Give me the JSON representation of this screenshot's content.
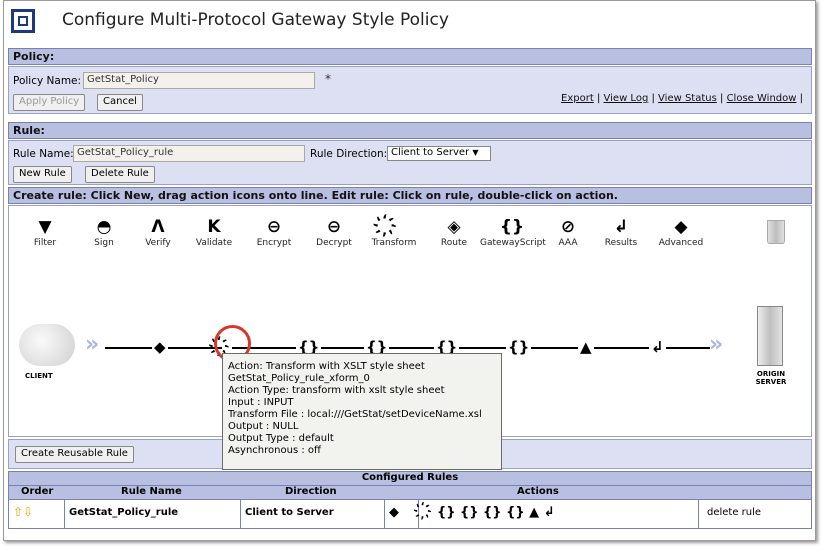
{
  "window": {
    "title": "Configure Multi-Protocol Gateway Style Policy"
  },
  "policy": {
    "header": "Policy:",
    "name_label": "Policy Name:",
    "name_value": "GetStat_Policy",
    "required_marker": "*",
    "apply_label": "Apply Policy",
    "cancel_label": "Cancel",
    "links": [
      "Export",
      "View Log",
      "View Status",
      "Close Window"
    ],
    "separator": "|"
  },
  "rule": {
    "header": "Rule:",
    "name_label": "Rule Name:",
    "name_value": "GetStat_Policy_rule",
    "direction_label": "Rule Direction:",
    "direction_value": "Client to Server",
    "direction_arrow": "▼",
    "new_label": "New Rule",
    "delete_label": "Delete Rule"
  },
  "instructions": "Create rule: Click New, drag action icons onto line.   Edit rule: Click on rule, double-click on action.",
  "palette": [
    {
      "label": "Filter",
      "icon": "filter-icon",
      "glyph": "▼"
    },
    {
      "label": "Sign",
      "icon": "sign-icon",
      "glyph": "◓"
    },
    {
      "label": "Verify",
      "icon": "verify-icon",
      "glyph": "Λ"
    },
    {
      "label": "Validate",
      "icon": "validate-icon",
      "glyph": "K"
    },
    {
      "label": "Encrypt",
      "icon": "encrypt-icon",
      "glyph": "⊖"
    },
    {
      "label": "Decrypt",
      "icon": "decrypt-icon",
      "glyph": "⊖"
    },
    {
      "label": "Transform",
      "icon": "transform-icon",
      "glyph": "҉"
    },
    {
      "label": "Route",
      "icon": "route-icon",
      "glyph": "◈"
    },
    {
      "label": "GatewayScript",
      "icon": "gatewayscript-icon",
      "glyph": "{}"
    },
    {
      "label": "AAA",
      "icon": "aaa-icon",
      "glyph": "⊘"
    },
    {
      "label": "Results",
      "icon": "results-icon",
      "glyph": "↲"
    },
    {
      "label": "Advanced",
      "icon": "advanced-icon",
      "glyph": "◆"
    }
  ],
  "rule_line": {
    "client_label": "CLIENT",
    "server_label": "ORIGIN SERVER",
    "chevrons": "»",
    "nodes": [
      "◆",
      "҉",
      "{}",
      "{}",
      "{}",
      "{}",
      "▲",
      "↲"
    ]
  },
  "tooltip": [
    "Action: Transform with XSLT style sheet",
    "GetStat_Policy_rule_xform_0",
    "Action Type: transform with xslt style sheet",
    "Input : INPUT",
    "Transform File : local:///GetStat/setDeviceName.xsl",
    "Output : NULL",
    "Output Type : default",
    "Asynchronous : off"
  ],
  "reusable_label": "Create Reusable Rule",
  "configured_rules": {
    "title": "Configured Rules",
    "columns": [
      "Order",
      "Rule Name",
      "Direction",
      "Actions"
    ],
    "rows": [
      {
        "order": "⇧⇩",
        "name": "GetStat_Policy_rule",
        "direction": "Client to Server",
        "lead": "◆",
        "actions": "҉ {} {} {} {} ▲ ↲",
        "delete": "delete rule"
      }
    ]
  }
}
